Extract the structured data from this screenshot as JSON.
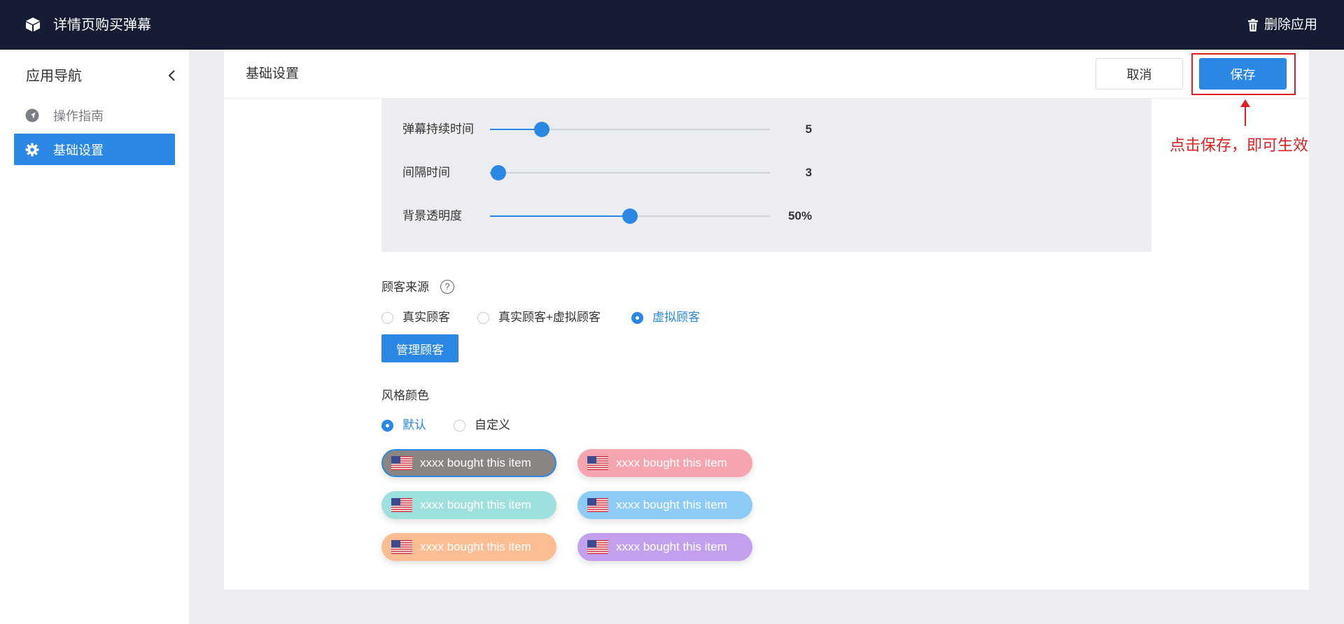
{
  "topbar": {
    "title": "详情页购买弹幕",
    "delete_label": "删除应用"
  },
  "sidebar": {
    "title": "应用导航",
    "items": [
      {
        "label": "操作指南",
        "icon": "navigation-icon",
        "active": false
      },
      {
        "label": "基础设置",
        "icon": "gear-icon",
        "active": true
      }
    ]
  },
  "panel": {
    "title": "基础设置",
    "cancel_label": "取消",
    "save_label": "保存",
    "annotation": "点击保存，即可生效"
  },
  "sliders": [
    {
      "label": "弹幕持续时间",
      "value_text": "5",
      "fraction": 0.186
    },
    {
      "label": "间隔时间",
      "value_text": "3",
      "fraction": 0.03
    },
    {
      "label": "背景透明度",
      "value_text": "50%",
      "fraction": 0.5
    }
  ],
  "customer_source": {
    "label": "顾客来源",
    "help": "?",
    "options": [
      "真实顾客",
      "真实顾客+虚拟顾客",
      "虚拟顾客"
    ],
    "selected": "虚拟顾客",
    "manage_label": "管理顾客"
  },
  "style_color": {
    "label": "风格颜色",
    "options": [
      "默认",
      "自定义"
    ],
    "selected": "默认",
    "chip_text": "xxxx bought this item",
    "chips": [
      {
        "color": "#8a8583",
        "selected": true
      },
      {
        "color": "#f6a4ae",
        "selected": false
      },
      {
        "color": "#9ee0de",
        "selected": false
      },
      {
        "color": "#8dcbf7",
        "selected": false
      },
      {
        "color": "#fdbd92",
        "selected": false
      },
      {
        "color": "#c3a0ee",
        "selected": false
      }
    ]
  },
  "colors": {
    "accent": "#2a87e3",
    "topbar": "#151c33",
    "annotation": "#e02020"
  }
}
